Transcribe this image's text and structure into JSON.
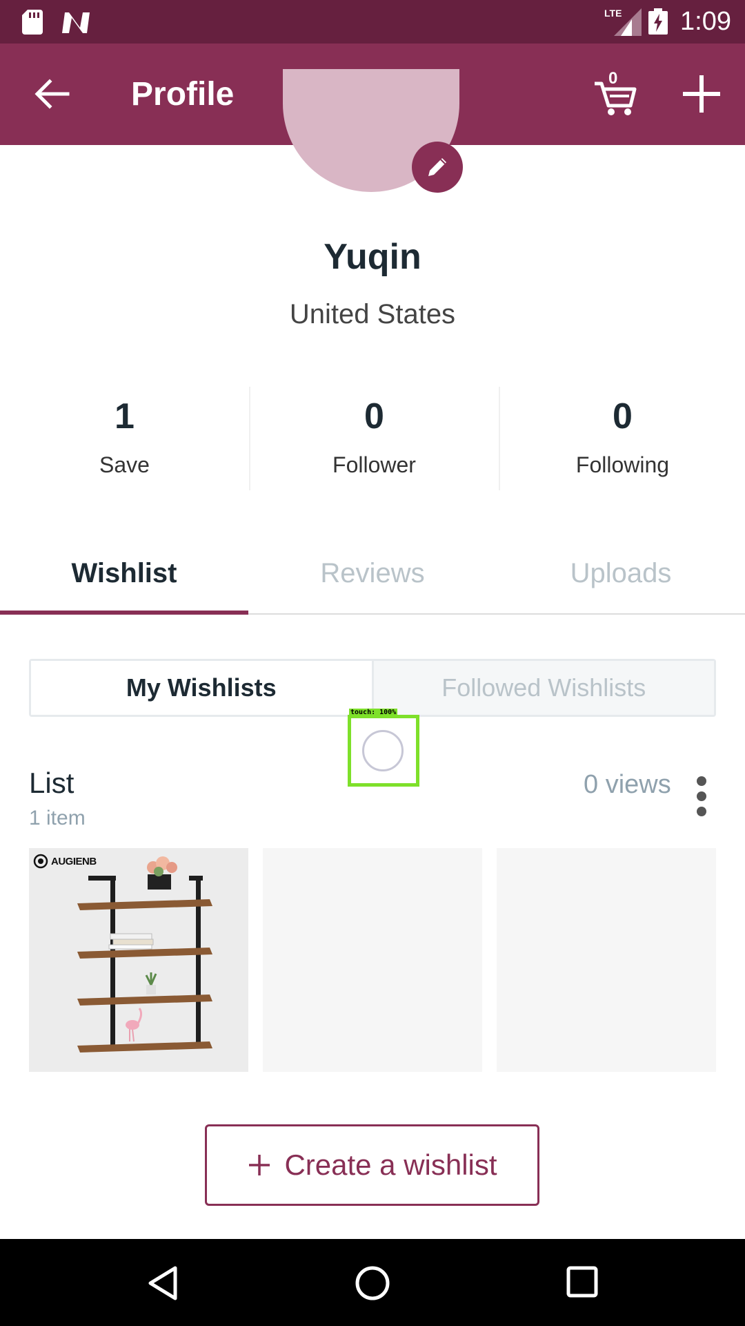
{
  "status_bar": {
    "time": "1:09",
    "network": "LTE"
  },
  "app_bar": {
    "title": "Profile",
    "cart_count": "0"
  },
  "profile": {
    "name": "Yuqin",
    "country": "United States"
  },
  "stats": [
    {
      "value": "1",
      "label": "Save"
    },
    {
      "value": "0",
      "label": "Follower"
    },
    {
      "value": "0",
      "label": "Following"
    }
  ],
  "tabs": [
    "Wishlist",
    "Reviews",
    "Uploads"
  ],
  "segment": [
    "My Wishlists",
    "Followed Wishlists"
  ],
  "touch_overlay": {
    "label": "touch: 100%"
  },
  "list": {
    "title": "List",
    "count": "1 item",
    "views": "0 views",
    "brand": "AUGIENB"
  },
  "create_button": {
    "label": "Create a wishlist"
  },
  "colors": {
    "status_bar": "#66203f",
    "app_bar": "#882f55",
    "accent": "#882f55"
  },
  "icons": [
    "sd-card-icon",
    "n-logo-icon",
    "lte-signal-icon",
    "battery-charging-icon",
    "back-arrow-icon",
    "cart-icon",
    "plus-icon",
    "pencil-icon",
    "more-vert-icon",
    "nav-back-icon",
    "nav-home-icon",
    "nav-recents-icon"
  ]
}
